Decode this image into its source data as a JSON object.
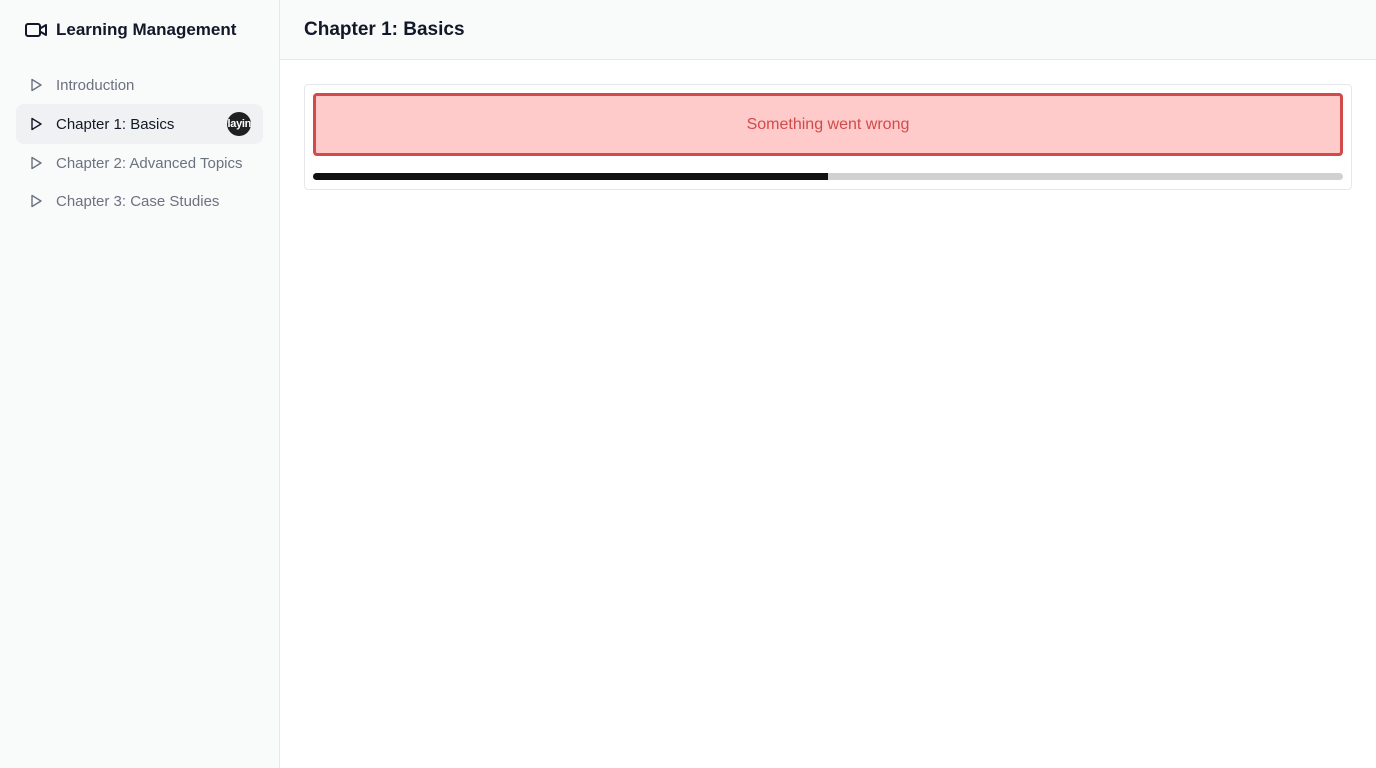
{
  "app": {
    "title": "Learning Management",
    "brand_icon": "video-camera-icon"
  },
  "sidebar": {
    "items": [
      {
        "label": "Introduction",
        "icon": "play-icon",
        "active": false
      },
      {
        "label": "Chapter 1: Basics",
        "icon": "play-icon",
        "active": true,
        "badge": "Playing"
      },
      {
        "label": "Chapter 2: Advanced Topics",
        "icon": "play-icon",
        "active": false
      },
      {
        "label": "Chapter 3: Case Studies",
        "icon": "play-icon",
        "active": false
      }
    ]
  },
  "header": {
    "title": "Chapter 1: Basics"
  },
  "player": {
    "error_message": "Something went wrong",
    "progress_fraction": 0.5
  },
  "colors": {
    "error_bg": "#fecaca",
    "error_border": "#d14b4b",
    "progress_fill": "#111111",
    "progress_track": "#d1d1d1"
  }
}
